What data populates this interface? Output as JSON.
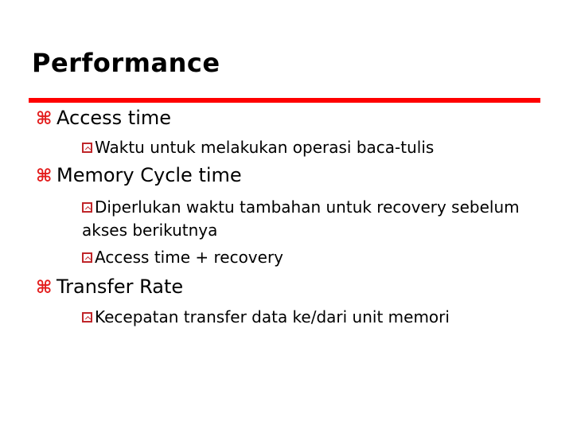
{
  "slide": {
    "title": "Performance",
    "accent_color": "#ff0000",
    "bullets": [
      {
        "icon": "command-icon",
        "text": "Access time",
        "sub": [
          {
            "icon": "boxed-chevron-icon",
            "text": "Waktu untuk melakukan operasi baca-tulis"
          }
        ]
      },
      {
        "icon": "command-icon",
        "text": "Memory Cycle time",
        "sub": [
          {
            "icon": "boxed-chevron-icon",
            "line1": "Diperlukan waktu tambahan untuk recovery sebelum",
            "line2": "akses berikutnya"
          },
          {
            "icon": "boxed-chevron-icon",
            "text": "Access time + recovery"
          }
        ]
      },
      {
        "icon": "command-icon",
        "text": "Transfer Rate",
        "sub": [
          {
            "icon": "boxed-chevron-icon",
            "text": "Kecepatan transfer data ke/dari unit memori"
          }
        ]
      }
    ],
    "bullet_glyph": "⌘"
  }
}
